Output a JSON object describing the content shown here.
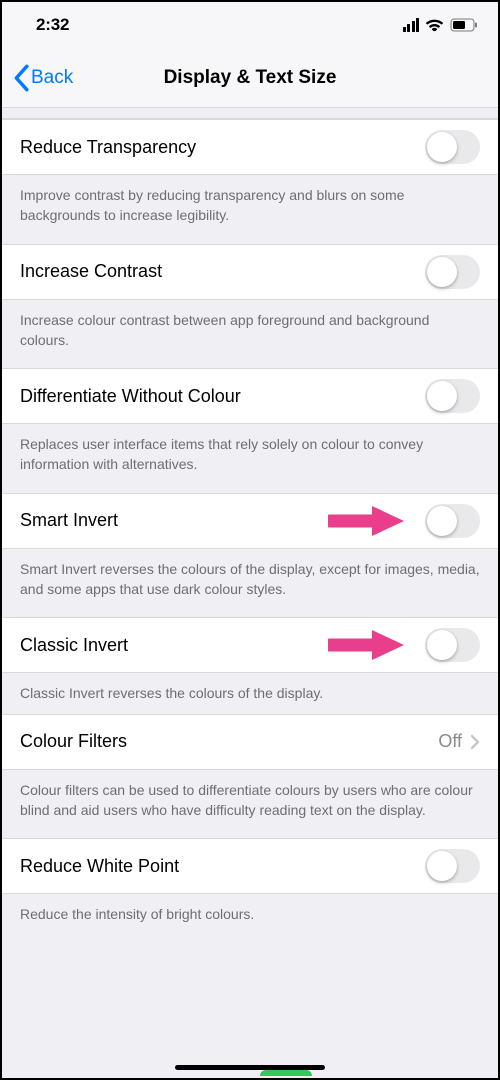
{
  "status": {
    "time": "2:32"
  },
  "nav": {
    "back": "Back",
    "title": "Display & Text Size"
  },
  "rows": {
    "reduce_transparency": {
      "label": "Reduce Transparency",
      "footer": "Improve contrast by reducing transparency and blurs on some backgrounds to increase legibility."
    },
    "increase_contrast": {
      "label": "Increase Contrast",
      "footer": "Increase colour contrast between app foreground and background colours."
    },
    "differentiate_without_colour": {
      "label": "Differentiate Without Colour",
      "footer": "Replaces user interface items that rely solely on colour to convey information with alternatives."
    },
    "smart_invert": {
      "label": "Smart Invert",
      "footer": "Smart Invert reverses the colours of the display, except for images, media, and some apps that use dark colour styles."
    },
    "classic_invert": {
      "label": "Classic Invert",
      "footer": "Classic Invert reverses the colours of the display."
    },
    "colour_filters": {
      "label": "Colour Filters",
      "value": "Off",
      "footer": "Colour filters can be used to differentiate colours by users who are colour blind and aid users who have difficulty reading text on the display."
    },
    "reduce_white_point": {
      "label": "Reduce White Point",
      "footer": "Reduce the intensity of bright colours."
    }
  },
  "annotation": {
    "color": "#e83e8c"
  }
}
